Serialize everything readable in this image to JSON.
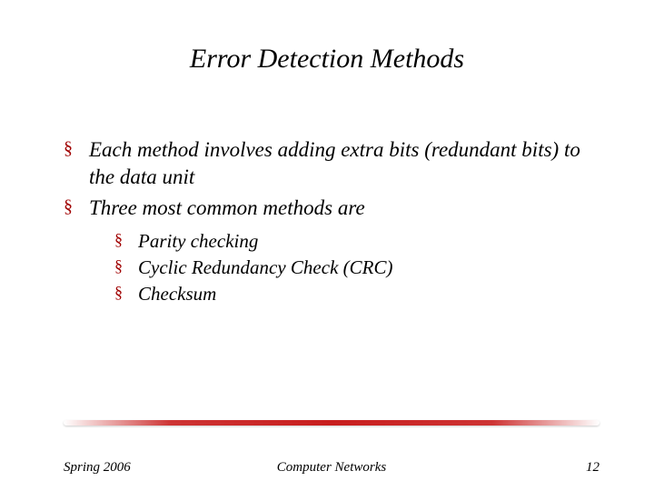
{
  "title": "Error Detection Methods",
  "bullets": {
    "b0": "Each method involves adding extra bits (redundant bits) to the data unit",
    "b1": "Three most common methods are"
  },
  "subbullets": {
    "s0": "Parity checking",
    "s1": "Cyclic Redundancy Check (CRC)",
    "s2": "Checksum"
  },
  "footer": {
    "left": "Spring 2006",
    "center": "Computer Networks",
    "right": "12"
  }
}
